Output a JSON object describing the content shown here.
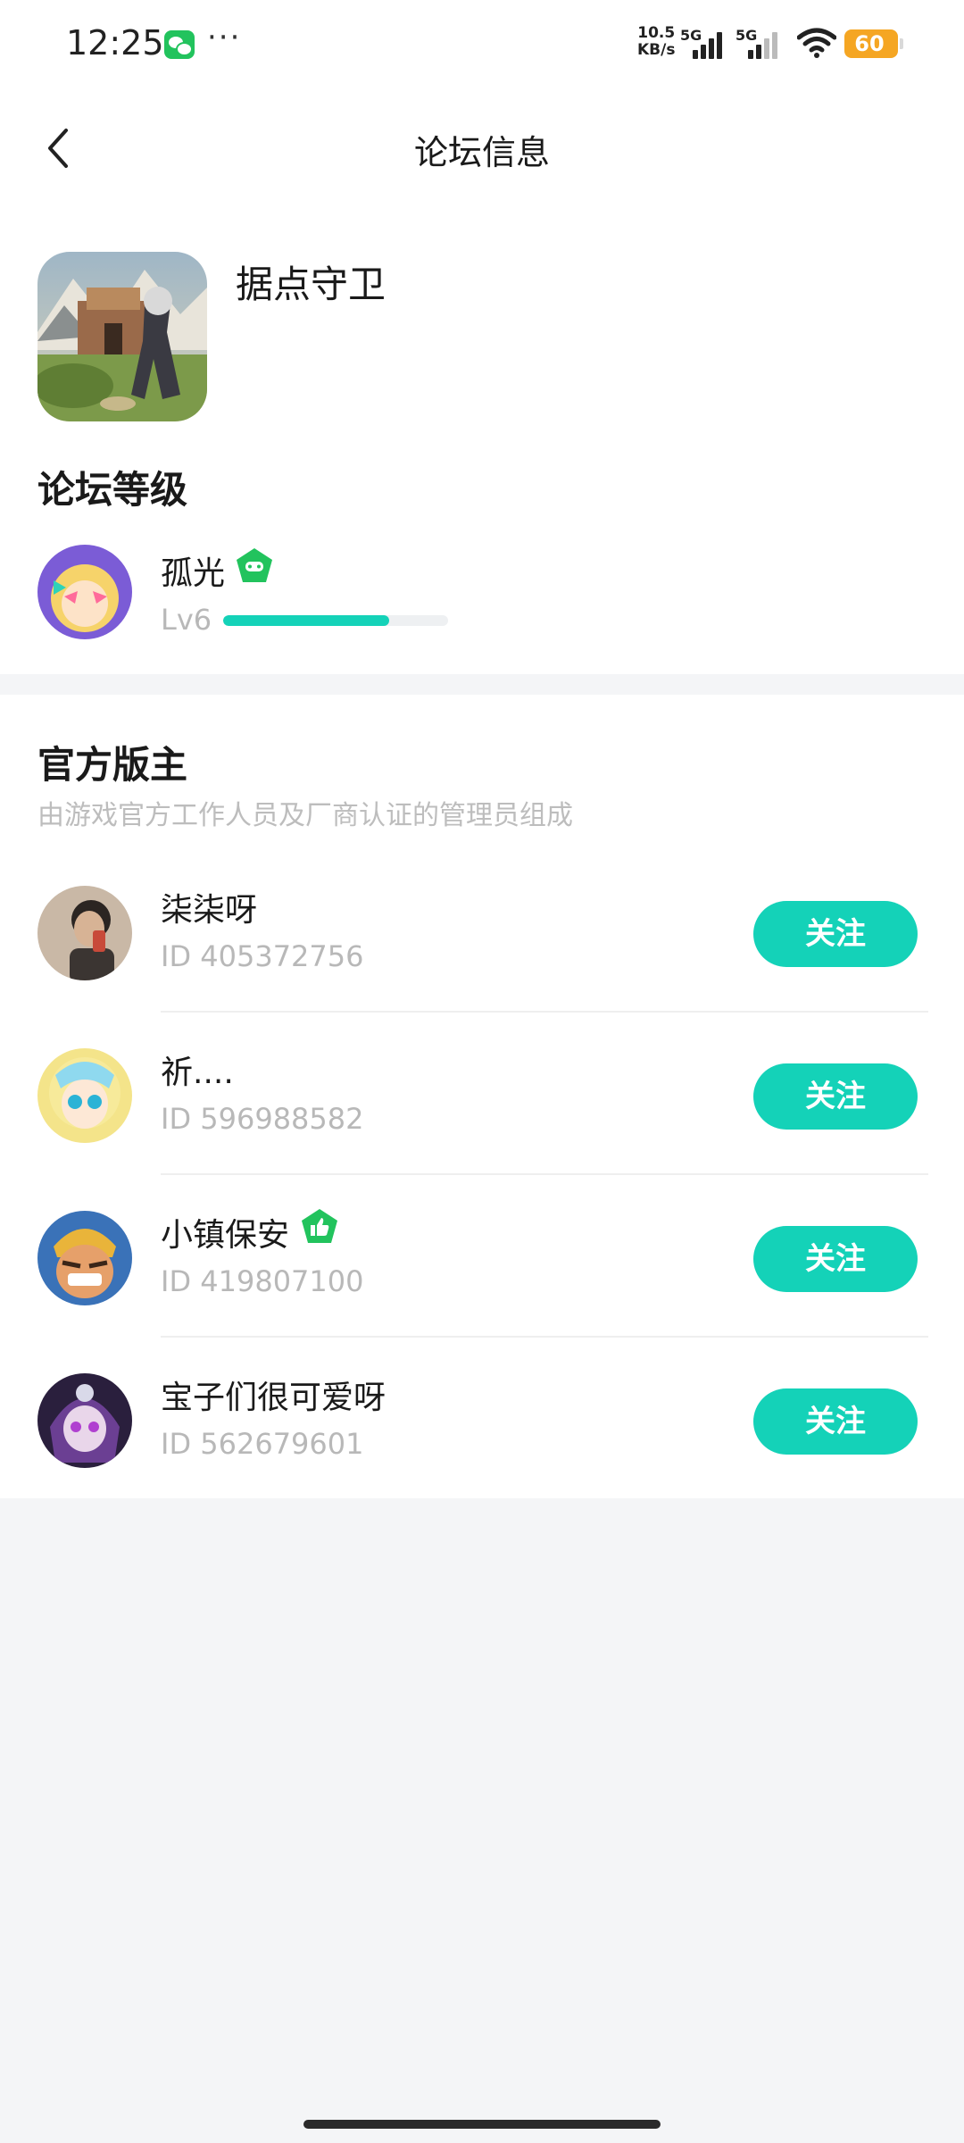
{
  "status_bar": {
    "time": "12:25",
    "more": "···",
    "net_speed_value": "10.5",
    "net_speed_unit": "KB/s",
    "sim1": "5G",
    "sim2": "5G",
    "battery": "60",
    "icons": [
      "wechat-icon",
      "signal-icon",
      "wifi-icon",
      "battery-icon"
    ]
  },
  "header": {
    "title": "论坛信息",
    "back_icon": "chevron-left-icon"
  },
  "forum": {
    "game_name": "据点守卫",
    "level_section_title": "论坛等级",
    "user_name": "孤光",
    "level": "Lv6",
    "level_progress": 0.74,
    "badge_icon": "game-controller-badge-icon"
  },
  "moderators": {
    "title": "官方版主",
    "subtitle": "由游戏官方工作人员及厂商认证的管理员组成",
    "follow_label": "关注",
    "items": [
      {
        "name": "柒柒呀",
        "id": "ID 405372756",
        "badge": ""
      },
      {
        "name": "祈....",
        "id": "ID 596988582",
        "badge": ""
      },
      {
        "name": "小镇保安",
        "id": "ID 419807100",
        "badge": "thumbs-up-badge-icon"
      },
      {
        "name": "宝子们很可爱呀",
        "id": "ID 562679601",
        "badge": ""
      }
    ]
  },
  "colors": {
    "accent": "#14d2b8",
    "badge_green": "#22c35d",
    "battery": "#f5a623",
    "page_bg": "#f4f5f7"
  }
}
